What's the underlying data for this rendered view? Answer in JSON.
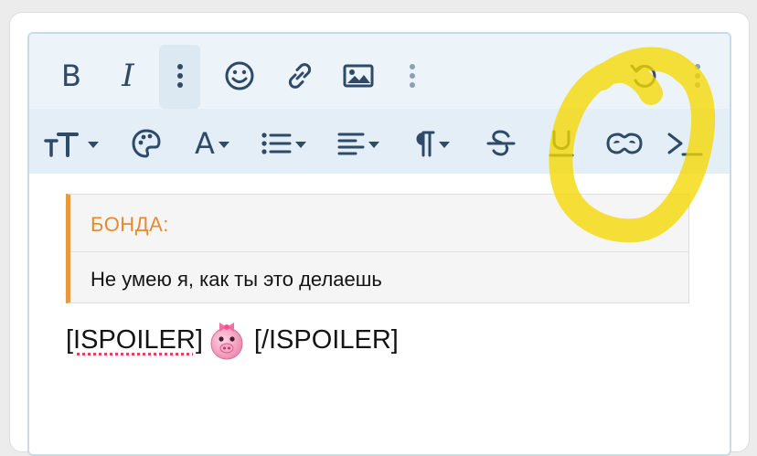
{
  "toolbar": {
    "bold": "B",
    "italic": "I",
    "text_color_letter": "A"
  },
  "icons": {
    "row1": [
      "bold-icon",
      "italic-icon",
      "more-vertical-icon",
      "smiley-icon",
      "link-icon",
      "image-icon",
      "more-vertical-icon",
      "undo-icon",
      "more-vertical-icon"
    ],
    "row2": [
      "font-size-icon",
      "palette-icon",
      "text-color-icon",
      "list-icon",
      "align-icon",
      "paragraph-icon",
      "strikethrough-icon",
      "underline-icon",
      "spoiler-mask-icon",
      "terminal-icon"
    ]
  },
  "quote": {
    "author": "БОНДА:",
    "text": "Не умею я, как ты это делаешь"
  },
  "body": {
    "open_tag": "[ISPOILER]",
    "close_tag": "[/ISPOILER]",
    "emoji": "pig-smiley-icon"
  },
  "colors": {
    "accent_quote": "#e89a3a",
    "author": "#e68a2e",
    "toolbar_bg": "#ecf3f9",
    "toolbar_row2_bg": "#e3eef7",
    "icon": "#2e4a67",
    "highlight": "#f5d800",
    "spellcheck": "#e0465b"
  }
}
